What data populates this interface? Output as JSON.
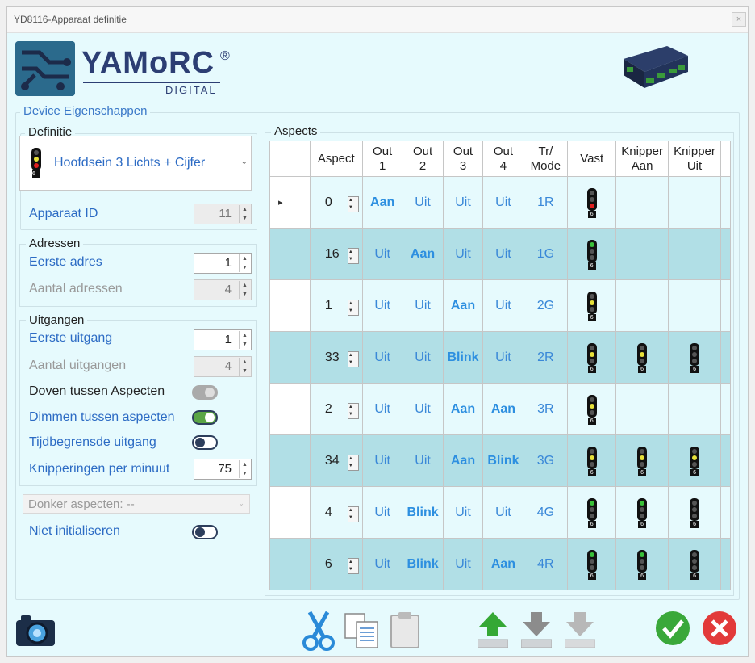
{
  "window": {
    "title": "YD8116-Apparaat definitie",
    "close_glyph": "×"
  },
  "logo": {
    "brand": "YAMoRC",
    "reg": "®",
    "sub": "DIGITAL"
  },
  "device_group": {
    "legend": "Device Eigenschappen"
  },
  "definitie": {
    "legend": "Definitie",
    "value": "Hoofdsein 3 Lichts + Cijfer",
    "plate": "6",
    "apparaat_id_label": "Apparaat ID",
    "apparaat_id_value": "11"
  },
  "adressen": {
    "legend": "Adressen",
    "eerste_adres_label": "Eerste adres",
    "eerste_adres_value": "1",
    "aantal_adressen_label": "Aantal adressen",
    "aantal_adressen_value": "4"
  },
  "uitgangen": {
    "legend": "Uitgangen",
    "eerste_uitgang_label": "Eerste uitgang",
    "eerste_uitgang_value": "1",
    "aantal_uitgangen_label": "Aantal uitgangen",
    "aantal_uitgangen_value": "4",
    "doven_label": "Doven tussen Aspecten",
    "doven_state": "disabled",
    "dimmen_label": "Dimmen tussen aspecten",
    "dimmen_state": "on",
    "tijd_label": "Tijdbegrensde uitgang",
    "tijd_state": "off",
    "knipper_label": "Knipperingen per minuut",
    "knipper_value": "75"
  },
  "donker": {
    "value": "Donker aspecten: --"
  },
  "niet_init": {
    "label": "Niet initialiseren",
    "state": "off"
  },
  "aspects": {
    "legend": "Aspects",
    "row_marker": "▸",
    "headers": {
      "aspect": "Aspect",
      "out1_a": "Out",
      "out1_b": "1",
      "out2_a": "Out",
      "out2_b": "2",
      "out3_a": "Out",
      "out3_b": "3",
      "out4_a": "Out",
      "out4_b": "4",
      "mode_a": "Tr/",
      "mode_b": "Mode",
      "vast": "Vast",
      "kaan_a": "Knipper",
      "kaan_b": "Aan",
      "kuit_a": "Knipper",
      "kuit_b": "Uit"
    },
    "rows": [
      {
        "aspect": "0",
        "o1": "Aan",
        "o2": "Uit",
        "o3": "Uit",
        "o4": "Uit",
        "mode": "1R",
        "plate": "6"
      },
      {
        "aspect": "16",
        "o1": "Uit",
        "o2": "Aan",
        "o3": "Uit",
        "o4": "Uit",
        "mode": "1G",
        "plate": "6"
      },
      {
        "aspect": "1",
        "o1": "Uit",
        "o2": "Uit",
        "o3": "Aan",
        "o4": "Uit",
        "mode": "2G",
        "plate": "6"
      },
      {
        "aspect": "33",
        "o1": "Uit",
        "o2": "Uit",
        "o3": "Blink",
        "o4": "Uit",
        "mode": "2R",
        "plate": "6"
      },
      {
        "aspect": "2",
        "o1": "Uit",
        "o2": "Uit",
        "o3": "Aan",
        "o4": "Aan",
        "mode": "3R",
        "plate": "6"
      },
      {
        "aspect": "34",
        "o1": "Uit",
        "o2": "Uit",
        "o3": "Aan",
        "o4": "Blink",
        "mode": "3G",
        "plate": "6"
      },
      {
        "aspect": "4",
        "o1": "Uit",
        "o2": "Blink",
        "o3": "Uit",
        "o4": "Uit",
        "mode": "4G",
        "plate": "6"
      },
      {
        "aspect": "6",
        "o1": "Uit",
        "o2": "Blink",
        "o3": "Uit",
        "o4": "Aan",
        "mode": "4R",
        "plate": "6"
      }
    ]
  },
  "colors": {
    "accent": "#2d8fe0",
    "row_alt": "#b1dfe6",
    "label_blue": "#2c6bc4",
    "bg": "#e6fafd"
  }
}
